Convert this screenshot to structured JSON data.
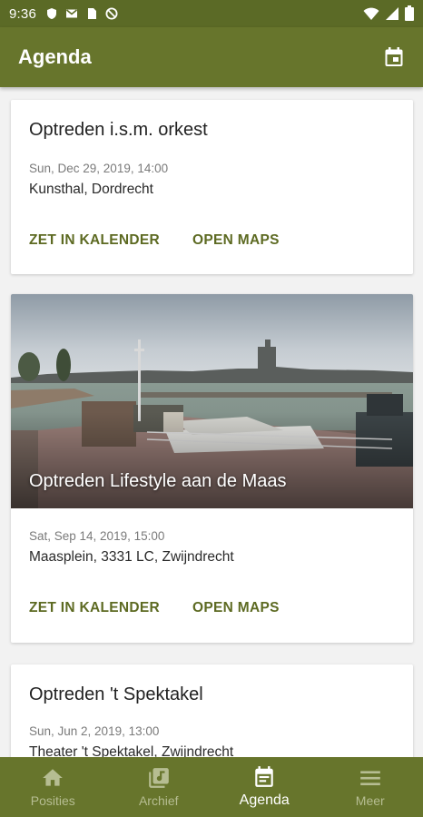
{
  "status_bar": {
    "time": "9:36",
    "left_icons": [
      "shield-icon",
      "gmail-icon",
      "sim-card-icon",
      "no-disturb-icon"
    ],
    "right_icons": [
      "wifi-icon",
      "signal-icon",
      "battery-icon"
    ]
  },
  "app_bar": {
    "title": "Agenda",
    "action_icon": "calendar-today-icon"
  },
  "events": [
    {
      "title": "Optreden i.s.m. orkest",
      "date": "Sun, Dec 29, 2019, 14:00",
      "location": "Kunsthal, Dordrecht",
      "has_image": false,
      "actions": [
        "ZET IN KALENDER",
        "OPEN MAPS"
      ]
    },
    {
      "title": "Optreden Lifestyle aan de Maas",
      "date": "Sat, Sep 14, 2019, 15:00",
      "location": "Maasplein, 3331 LC, Zwijndrecht",
      "has_image": true,
      "actions": [
        "ZET IN KALENDER",
        "OPEN MAPS"
      ]
    },
    {
      "title": "Optreden 't Spektakel",
      "date": "Sun, Jun 2, 2019, 13:00",
      "location": "Theater 't Spektakel, Zwijndrecht",
      "has_image": false,
      "actions": []
    }
  ],
  "bottom_nav": [
    {
      "label": "Posities",
      "icon": "home-icon",
      "active": false
    },
    {
      "label": "Archief",
      "icon": "music-library-icon",
      "active": false
    },
    {
      "label": "Agenda",
      "icon": "calendar-icon",
      "active": true
    },
    {
      "label": "Meer",
      "icon": "menu-icon",
      "active": false
    }
  ],
  "colors": {
    "primary": "#67752c",
    "status_bar": "#5b6a26",
    "accent_text": "#5d6a22",
    "inactive_nav": "#b6bd92"
  }
}
